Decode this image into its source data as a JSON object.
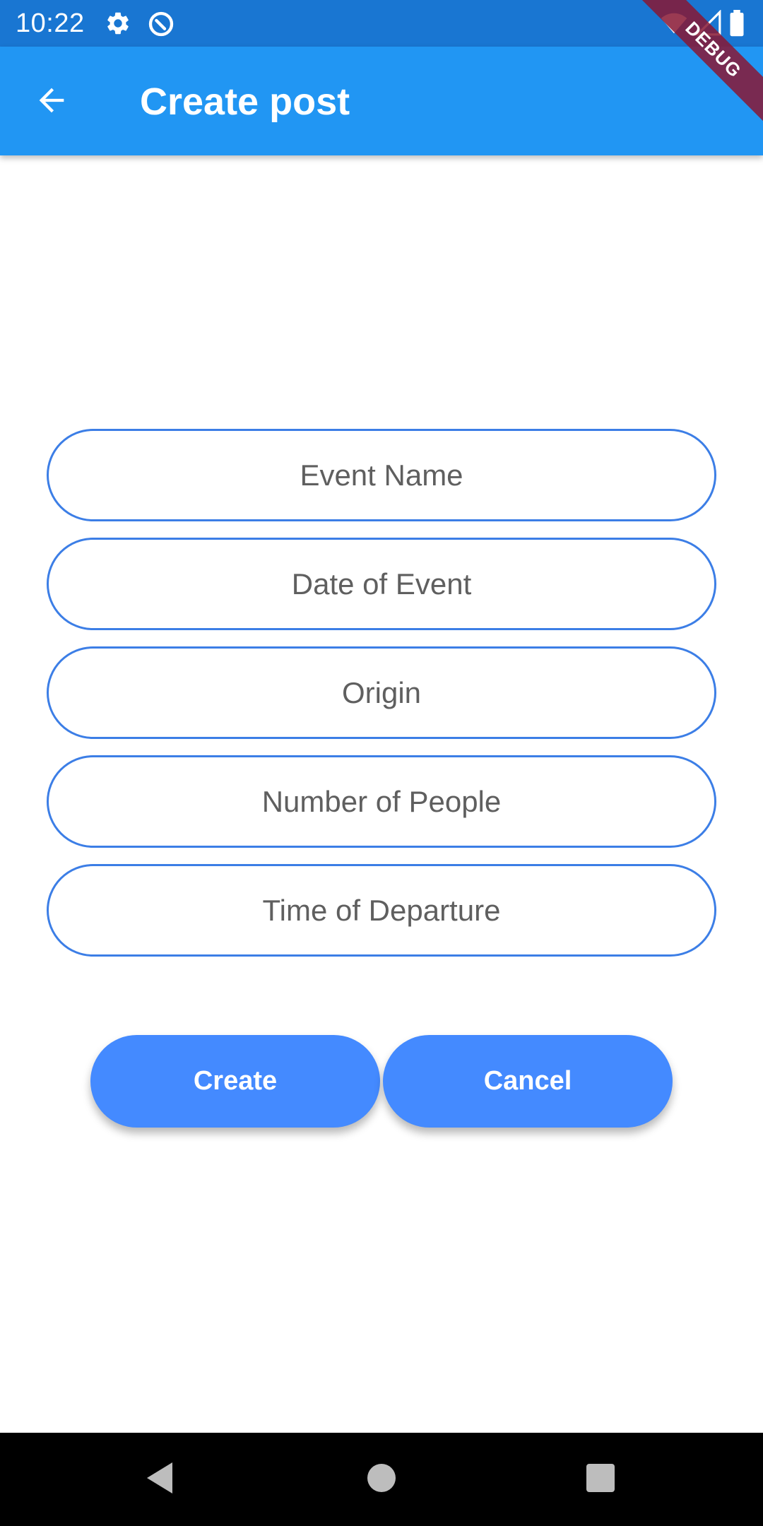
{
  "status_bar": {
    "time": "10:22",
    "icons": [
      "gear-icon",
      "data-saver-icon",
      "wifi-icon",
      "signal-icon",
      "battery-icon"
    ],
    "background_color": "#1976D2"
  },
  "app_bar": {
    "title": "Create post",
    "back_icon": "arrow-back-icon",
    "background_color": "#2196F3"
  },
  "debug_banner": {
    "label": "DEBUG"
  },
  "form": {
    "border_color": "#3C7EE6",
    "fields": [
      {
        "placeholder": "Event Name",
        "value": ""
      },
      {
        "placeholder": "Date of Event",
        "value": ""
      },
      {
        "placeholder": "Origin",
        "value": ""
      },
      {
        "placeholder": "Number of People",
        "value": ""
      },
      {
        "placeholder": "Time of Departure",
        "value": ""
      }
    ]
  },
  "actions": {
    "create_label": "Create",
    "cancel_label": "Cancel",
    "button_color": "#448AFF"
  },
  "nav_bar": {
    "icons": [
      "back-triangle-icon",
      "home-circle-icon",
      "recents-square-icon"
    ]
  }
}
